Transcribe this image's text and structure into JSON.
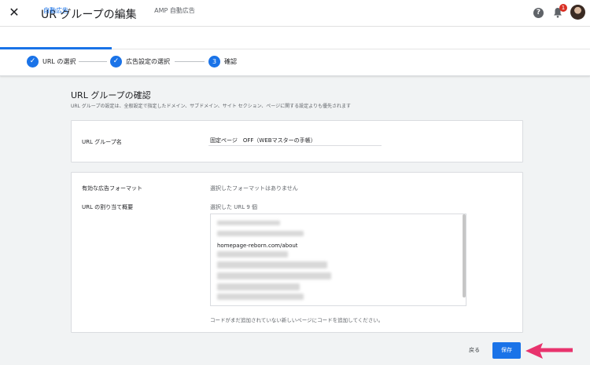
{
  "header": {
    "close_icon": "close-icon",
    "title": "UR グループの編集",
    "help_icon": "help-icon",
    "notification_count": "1",
    "bell_icon": "bell-icon",
    "avatar_icon": "avatar"
  },
  "tabs": [
    {
      "label": "自動広告"
    },
    {
      "label": "AMP 自動広告"
    }
  ],
  "stepper": {
    "steps": [
      {
        "label": "URL の選択",
        "status": "done",
        "marker": "✓"
      },
      {
        "label": "広告設定の選択",
        "status": "done",
        "marker": "✓"
      },
      {
        "label": "確認",
        "status": "current",
        "marker": "3"
      }
    ]
  },
  "main": {
    "heading": "URL グループの確認",
    "description": "URL グループの設定は、全般設定で指定したドメイン、サブドメイン、サイト セクション、ページに関する設定よりも優先されます",
    "group_name_label": "URL グループ名",
    "group_name_value": "固定ページ　OFF（WEBマスターの手帳）",
    "formats_label": "有効な広告フォーマット",
    "formats_value": "選択したフォーマットはありません",
    "url_assign_label": "URL の割り当て概要",
    "selected_urls": "選択した URL 9 個",
    "visible_url": "homepage-reborn.com/about",
    "note": "コードがまだ追加されていない新しいページにコードを追加してください。"
  },
  "footer": {
    "back_label": "戻る",
    "save_label": "保存"
  },
  "colors": {
    "accent": "#1a73e8",
    "annotation_arrow": "#e8336d",
    "badge": "#d93025"
  }
}
